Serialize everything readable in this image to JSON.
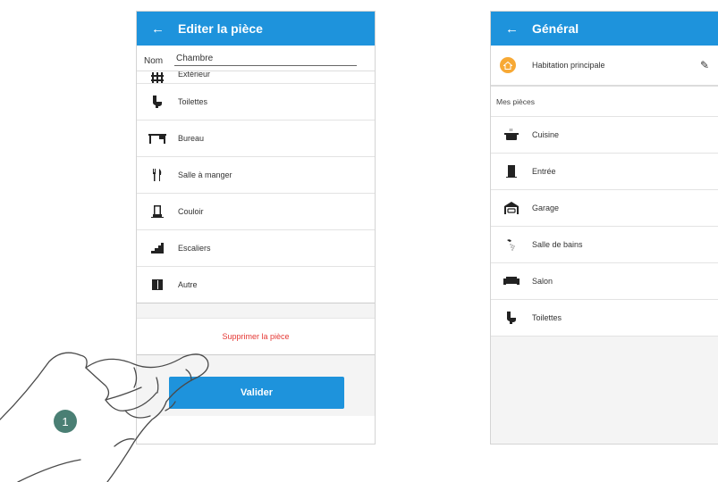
{
  "left_screen": {
    "back_icon": "arrow-left-icon",
    "title": "Editer la pièce",
    "name_label": "Nom",
    "name_value": "Chambre",
    "partial_item": {
      "label": "Extérieur",
      "icon": "fence-icon"
    },
    "rooms": [
      {
        "label": "Toilettes",
        "icon": "toilet-icon"
      },
      {
        "label": "Bureau",
        "icon": "desk-icon"
      },
      {
        "label": "Salle à manger",
        "icon": "cutlery-icon"
      },
      {
        "label": "Couloir",
        "icon": "corridor-icon"
      },
      {
        "label": "Escaliers",
        "icon": "stairs-icon"
      },
      {
        "label": "Autre",
        "icon": "other-room-icon"
      }
    ],
    "delete_label": "Supprimer la pièce",
    "validate_label": "Valider",
    "accent_color": "#1e93dc",
    "delete_color": "#e53935"
  },
  "right_screen": {
    "back_icon": "arrow-left-icon",
    "title": "Général",
    "home_label": "Habitation principale",
    "home_icon": "house-icon",
    "edit_icon": "pencil-icon",
    "section_title": "Mes pièces",
    "rooms": [
      {
        "label": "Cuisine",
        "icon": "pot-icon"
      },
      {
        "label": "Entrée",
        "icon": "door-icon"
      },
      {
        "label": "Garage",
        "icon": "garage-icon"
      },
      {
        "label": "Salle de bains",
        "icon": "shower-icon"
      },
      {
        "label": "Salon",
        "icon": "sofa-icon"
      },
      {
        "label": "Toilettes",
        "icon": "toilet-icon"
      }
    ],
    "badge_color": "#f7a935"
  },
  "annotation": {
    "step_number": "1",
    "hand_icon": "tapping-hand-icon"
  }
}
